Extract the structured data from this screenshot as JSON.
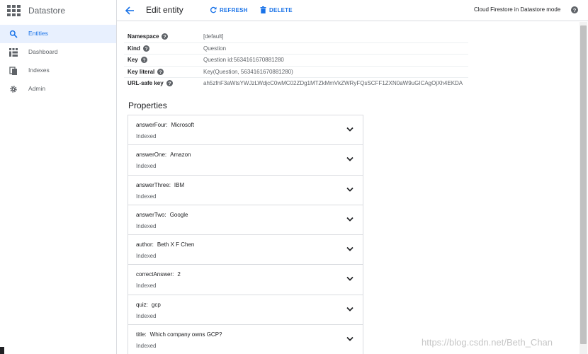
{
  "app": {
    "name": "Datastore"
  },
  "sidebar": {
    "items": [
      {
        "label": "Entities",
        "icon": "search-icon",
        "active": true
      },
      {
        "label": "Dashboard",
        "icon": "dashboard-icon",
        "active": false
      },
      {
        "label": "Indexes",
        "icon": "indexes-icon",
        "active": false
      },
      {
        "label": "Admin",
        "icon": "gear-icon",
        "active": false
      }
    ]
  },
  "topbar": {
    "title": "Edit entity",
    "refresh_label": "REFRESH",
    "delete_label": "DELETE",
    "mode_label": "Cloud Firestore in Datastore mode"
  },
  "entity": {
    "rows": [
      {
        "key": "Namespace",
        "value": "[default]"
      },
      {
        "key": "Kind",
        "value": "Question"
      },
      {
        "key": "Key",
        "value": "Question id:5634161670881280"
      },
      {
        "key": "Key literal",
        "value": "Key(Question, 5634161670881280)"
      },
      {
        "key": "URL-safe key",
        "value": "ah5zfnF3aWtsYWJzLWdjcC0wMC02ZDg1MTZkMmVkZWRyFQsSCFF1ZXN0aW9uGICAgOjXh4EKDA"
      }
    ]
  },
  "properties": {
    "title": "Properties",
    "items": [
      {
        "name": "answerFour:",
        "value": "Microsoft",
        "status": "Indexed"
      },
      {
        "name": "answerOne:",
        "value": "Amazon",
        "status": "Indexed"
      },
      {
        "name": "answerThree:",
        "value": "IBM",
        "status": "Indexed"
      },
      {
        "name": "answerTwo:",
        "value": "Google",
        "status": "Indexed"
      },
      {
        "name": "author:",
        "value": "Beth X F Chen",
        "status": "Indexed"
      },
      {
        "name": "correctAnswer:",
        "value": "2",
        "status": "Indexed"
      },
      {
        "name": "quiz:",
        "value": "gcp",
        "status": "Indexed"
      },
      {
        "name": "title:",
        "value": "Which company owns GCP?",
        "status": "Indexed"
      }
    ]
  },
  "watermark": "https://blog.csdn.net/Beth_Chan",
  "colors": {
    "accent": "#1a73e8",
    "active_bg": "#e8f0fe",
    "text": "#202124",
    "muted": "#5f6368"
  }
}
